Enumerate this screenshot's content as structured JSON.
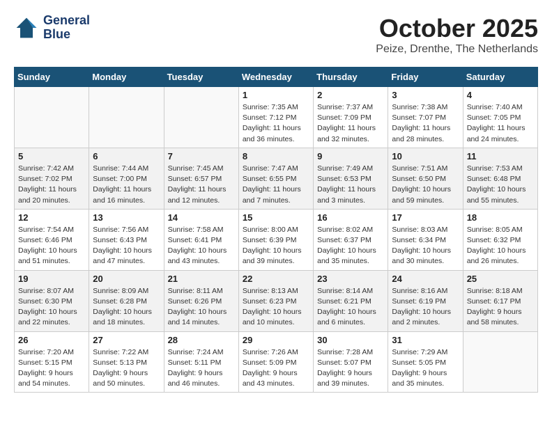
{
  "header": {
    "logo_line1": "General",
    "logo_line2": "Blue",
    "month_title": "October 2025",
    "location": "Peize, Drenthe, The Netherlands"
  },
  "days_of_week": [
    "Sunday",
    "Monday",
    "Tuesday",
    "Wednesday",
    "Thursday",
    "Friday",
    "Saturday"
  ],
  "weeks": [
    [
      {
        "day": "",
        "info": ""
      },
      {
        "day": "",
        "info": ""
      },
      {
        "day": "",
        "info": ""
      },
      {
        "day": "1",
        "info": "Sunrise: 7:35 AM\nSunset: 7:12 PM\nDaylight: 11 hours\nand 36 minutes."
      },
      {
        "day": "2",
        "info": "Sunrise: 7:37 AM\nSunset: 7:09 PM\nDaylight: 11 hours\nand 32 minutes."
      },
      {
        "day": "3",
        "info": "Sunrise: 7:38 AM\nSunset: 7:07 PM\nDaylight: 11 hours\nand 28 minutes."
      },
      {
        "day": "4",
        "info": "Sunrise: 7:40 AM\nSunset: 7:05 PM\nDaylight: 11 hours\nand 24 minutes."
      }
    ],
    [
      {
        "day": "5",
        "info": "Sunrise: 7:42 AM\nSunset: 7:02 PM\nDaylight: 11 hours\nand 20 minutes."
      },
      {
        "day": "6",
        "info": "Sunrise: 7:44 AM\nSunset: 7:00 PM\nDaylight: 11 hours\nand 16 minutes."
      },
      {
        "day": "7",
        "info": "Sunrise: 7:45 AM\nSunset: 6:57 PM\nDaylight: 11 hours\nand 12 minutes."
      },
      {
        "day": "8",
        "info": "Sunrise: 7:47 AM\nSunset: 6:55 PM\nDaylight: 11 hours\nand 7 minutes."
      },
      {
        "day": "9",
        "info": "Sunrise: 7:49 AM\nSunset: 6:53 PM\nDaylight: 11 hours\nand 3 minutes."
      },
      {
        "day": "10",
        "info": "Sunrise: 7:51 AM\nSunset: 6:50 PM\nDaylight: 10 hours\nand 59 minutes."
      },
      {
        "day": "11",
        "info": "Sunrise: 7:53 AM\nSunset: 6:48 PM\nDaylight: 10 hours\nand 55 minutes."
      }
    ],
    [
      {
        "day": "12",
        "info": "Sunrise: 7:54 AM\nSunset: 6:46 PM\nDaylight: 10 hours\nand 51 minutes."
      },
      {
        "day": "13",
        "info": "Sunrise: 7:56 AM\nSunset: 6:43 PM\nDaylight: 10 hours\nand 47 minutes."
      },
      {
        "day": "14",
        "info": "Sunrise: 7:58 AM\nSunset: 6:41 PM\nDaylight: 10 hours\nand 43 minutes."
      },
      {
        "day": "15",
        "info": "Sunrise: 8:00 AM\nSunset: 6:39 PM\nDaylight: 10 hours\nand 39 minutes."
      },
      {
        "day": "16",
        "info": "Sunrise: 8:02 AM\nSunset: 6:37 PM\nDaylight: 10 hours\nand 35 minutes."
      },
      {
        "day": "17",
        "info": "Sunrise: 8:03 AM\nSunset: 6:34 PM\nDaylight: 10 hours\nand 30 minutes."
      },
      {
        "day": "18",
        "info": "Sunrise: 8:05 AM\nSunset: 6:32 PM\nDaylight: 10 hours\nand 26 minutes."
      }
    ],
    [
      {
        "day": "19",
        "info": "Sunrise: 8:07 AM\nSunset: 6:30 PM\nDaylight: 10 hours\nand 22 minutes."
      },
      {
        "day": "20",
        "info": "Sunrise: 8:09 AM\nSunset: 6:28 PM\nDaylight: 10 hours\nand 18 minutes."
      },
      {
        "day": "21",
        "info": "Sunrise: 8:11 AM\nSunset: 6:26 PM\nDaylight: 10 hours\nand 14 minutes."
      },
      {
        "day": "22",
        "info": "Sunrise: 8:13 AM\nSunset: 6:23 PM\nDaylight: 10 hours\nand 10 minutes."
      },
      {
        "day": "23",
        "info": "Sunrise: 8:14 AM\nSunset: 6:21 PM\nDaylight: 10 hours\nand 6 minutes."
      },
      {
        "day": "24",
        "info": "Sunrise: 8:16 AM\nSunset: 6:19 PM\nDaylight: 10 hours\nand 2 minutes."
      },
      {
        "day": "25",
        "info": "Sunrise: 8:18 AM\nSunset: 6:17 PM\nDaylight: 9 hours\nand 58 minutes."
      }
    ],
    [
      {
        "day": "26",
        "info": "Sunrise: 7:20 AM\nSunset: 5:15 PM\nDaylight: 9 hours\nand 54 minutes."
      },
      {
        "day": "27",
        "info": "Sunrise: 7:22 AM\nSunset: 5:13 PM\nDaylight: 9 hours\nand 50 minutes."
      },
      {
        "day": "28",
        "info": "Sunrise: 7:24 AM\nSunset: 5:11 PM\nDaylight: 9 hours\nand 46 minutes."
      },
      {
        "day": "29",
        "info": "Sunrise: 7:26 AM\nSunset: 5:09 PM\nDaylight: 9 hours\nand 43 minutes."
      },
      {
        "day": "30",
        "info": "Sunrise: 7:28 AM\nSunset: 5:07 PM\nDaylight: 9 hours\nand 39 minutes."
      },
      {
        "day": "31",
        "info": "Sunrise: 7:29 AM\nSunset: 5:05 PM\nDaylight: 9 hours\nand 35 minutes."
      },
      {
        "day": "",
        "info": ""
      }
    ]
  ]
}
